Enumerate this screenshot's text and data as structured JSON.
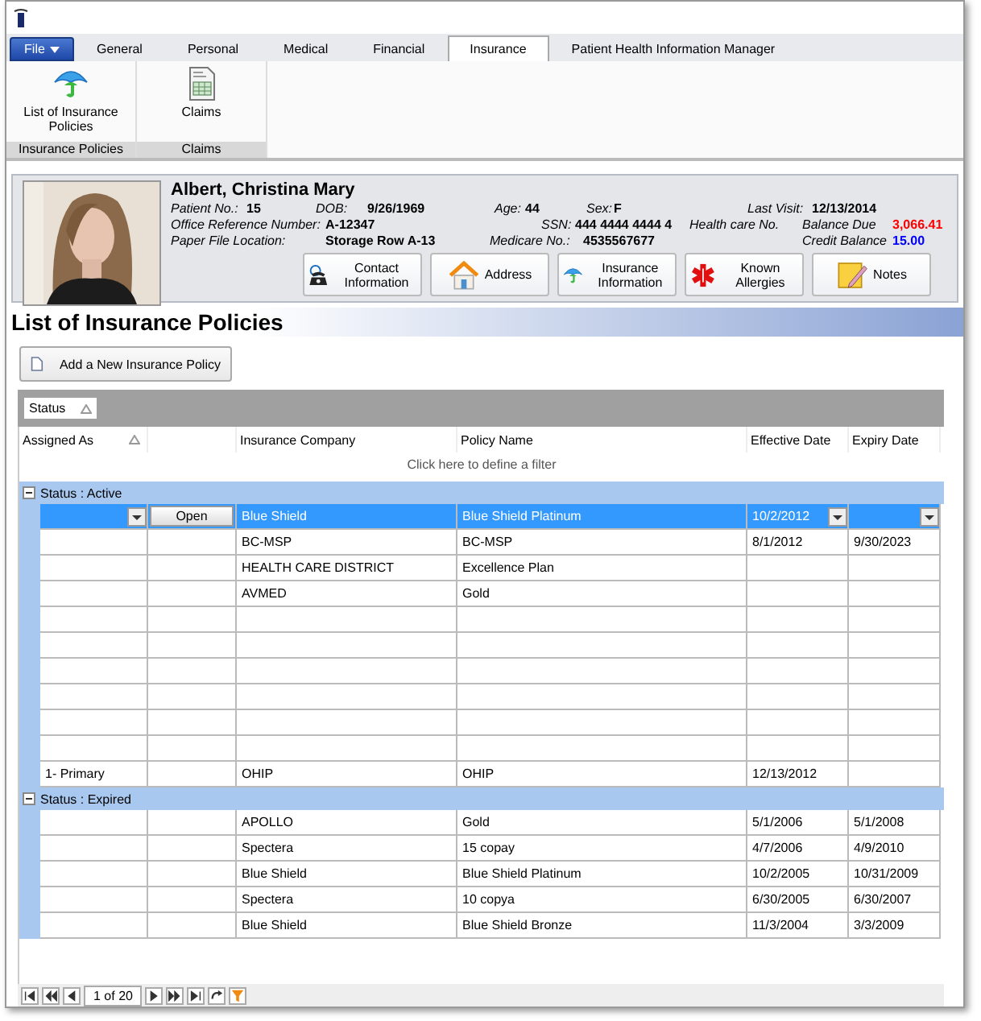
{
  "app": {
    "file_button": "File"
  },
  "tabs": [
    {
      "label": "General",
      "selected": false
    },
    {
      "label": "Personal",
      "selected": false
    },
    {
      "label": "Medical",
      "selected": false
    },
    {
      "label": "Financial",
      "selected": false
    },
    {
      "label": "Insurance",
      "selected": true
    },
    {
      "label": "Patient Health Information Manager",
      "selected": false
    }
  ],
  "ribbon_groups": [
    {
      "label": "Insurance Policies",
      "items": [
        {
          "label": "List of Insurance Policies",
          "kind": "insurance"
        }
      ]
    },
    {
      "label": "Claims",
      "items": [
        {
          "label": "Claims",
          "kind": "claims"
        }
      ]
    }
  ],
  "patient": {
    "photo": {
      "kind": "picture"
    },
    "name": "Albert, Christina Mary",
    "field_rows": [
      [
        {
          "label": "Patient No.:",
          "value": "15"
        },
        {
          "label": "DOB:",
          "value": "9/26/1969"
        },
        {
          "label": "Age:",
          "value": "44"
        },
        {
          "label": "Sex:",
          "value": "F"
        },
        {
          "label": "Last Visit:",
          "value": "12/13/2014"
        }
      ],
      [
        {
          "label": "Office Reference Number:",
          "value": "A-12347"
        },
        {
          "label": "SSN:",
          "value": "444 4444 4444 4"
        },
        {
          "label": "Health care No."
        },
        {
          "label": "Balance Due",
          "value": "3,066.41",
          "color": "#ff0000"
        }
      ],
      [
        {
          "label": "Paper File Location:",
          "value": "Storage Row A-13"
        },
        {
          "label": "Medicare No.:",
          "value": "4535567677"
        },
        {
          "label": "Credit Balance",
          "value": "15.00",
          "color": "#0000ff"
        }
      ]
    ],
    "buttons": [
      {
        "label": "Contact Information",
        "kind": "contact"
      },
      {
        "label": "Address",
        "kind": "address"
      },
      {
        "label": "Insurance Information",
        "kind": "insurance"
      },
      {
        "label": "Known Allergies",
        "kind": "allergies"
      },
      {
        "label": "Notes",
        "kind": "notes"
      }
    ]
  },
  "page_title": "List of Insurance Policies",
  "add_button": "Add a New Insurance Policy",
  "table": {
    "group_by": {
      "label": "Status"
    },
    "columns": [
      {
        "label": "Assigned As",
        "sorted": true
      },
      {
        "label": "Insurance Company",
        "sorted": false
      },
      {
        "label": "Policy Name",
        "sorted": false
      },
      {
        "label": "Effective Date",
        "sorted": false
      },
      {
        "label": "Expiry Date",
        "sorted": false
      }
    ],
    "filter_row": "Click here to define a filter",
    "groups": [
      {
        "label": "Status : Active",
        "expanded": true,
        "rows": [
          {
            "selected": true,
            "open_button": "Open",
            "company": "Blue Shield",
            "policy": "Blue Shield Platinum",
            "effective": "10/2/2012"
          },
          {
            "selected": false,
            "company": "BC-MSP",
            "policy": "BC-MSP",
            "effective": "8/1/2012",
            "expiry": "9/30/2023"
          },
          {
            "selected": false,
            "company": "HEALTH CARE DISTRICT",
            "policy": "Excellence Plan"
          },
          {
            "selected": false,
            "company": "AVMED",
            "policy": "Gold"
          },
          {
            "selected": false
          },
          {
            "selected": false
          },
          {
            "selected": false
          },
          {
            "selected": false
          },
          {
            "selected": false
          },
          {
            "selected": false
          },
          {
            "selected": false,
            "assigned_as": "1- Primary",
            "company": "OHIP",
            "policy": "OHIP",
            "effective": "12/13/2012"
          }
        ]
      },
      {
        "label": "Status : Expired",
        "expanded": true,
        "rows": [
          {
            "selected": false,
            "company": "APOLLO",
            "policy": "Gold",
            "effective": "5/1/2006",
            "expiry": "5/1/2008"
          },
          {
            "selected": false,
            "company": "Spectera",
            "policy": "15 copay",
            "effective": "4/7/2006",
            "expiry": "4/9/2010"
          },
          {
            "selected": false,
            "company": "Blue Shield",
            "policy": "Blue Shield Platinum",
            "effective": "10/2/2005",
            "expiry": "10/31/2009"
          },
          {
            "selected": false,
            "company": "Spectera",
            "policy": "10 copya",
            "effective": "6/30/2005",
            "expiry": "6/30/2007"
          },
          {
            "selected": false,
            "company": "Blue Shield",
            "policy": "Blue Shield Bronze",
            "effective": "11/3/2004",
            "expiry": "3/3/2009"
          }
        ]
      }
    ],
    "pager": {
      "page_text": "1 of 20"
    }
  }
}
